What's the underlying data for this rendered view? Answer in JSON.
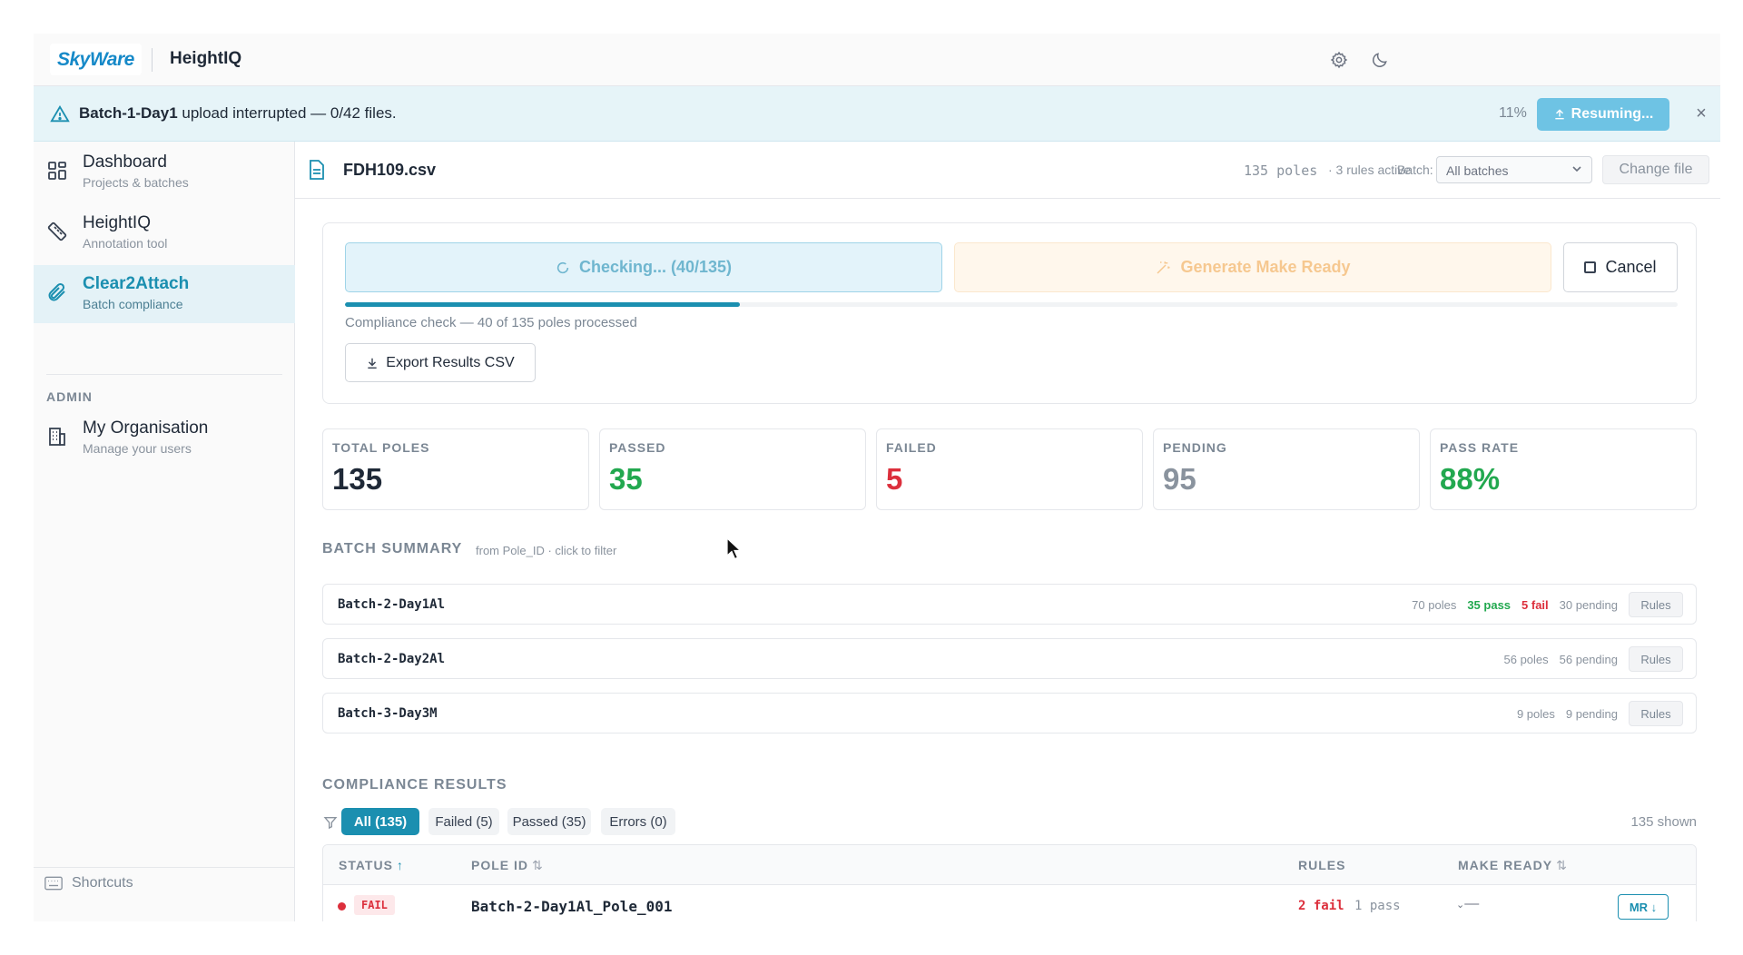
{
  "header": {
    "logo": "SkyWare",
    "app_title": "HeightIQ"
  },
  "banner": {
    "batch": "Batch-1-Day1",
    "message": " upload interrupted — 0/42 files.",
    "percent": "11%",
    "progress_fraction": 0.11,
    "resume_label": "Resuming...",
    "close": "×"
  },
  "sidebar": {
    "items": [
      {
        "label": "Dashboard",
        "sub": "Projects & batches",
        "icon": "dashboard-icon"
      },
      {
        "label": "HeightIQ",
        "sub": "Annotation tool",
        "icon": "ruler-icon"
      },
      {
        "label": "Clear2Attach",
        "sub": "Batch compliance",
        "icon": "paperclip-icon"
      }
    ],
    "admin_label": "ADMIN",
    "admin_items": [
      {
        "label": "My Organisation",
        "sub": "Manage your users",
        "icon": "building-icon"
      }
    ],
    "shortcuts_label": "Shortcuts",
    "collapse": "«"
  },
  "file_bar": {
    "file_name": "FDH109.csv",
    "poles": "135 poles",
    "rules_active": "· 3 rules active",
    "batch_label": "Batch:",
    "batch_value": "All batches",
    "change_file": "Change file"
  },
  "check": {
    "checking_label": "Checking... (40/135)",
    "generate_label": "Generate Make Ready",
    "cancel_label": "Cancel",
    "progress_fraction": 0.296,
    "progress_text": "Compliance check — 40 of 135 poles processed",
    "export_label": "Export Results CSV"
  },
  "stats": [
    {
      "label": "TOTAL POLES",
      "value": "135",
      "color": "#1f2937"
    },
    {
      "label": "PASSED",
      "value": "35",
      "color": "#22a84f"
    },
    {
      "label": "FAILED",
      "value": "5",
      "color": "#dc2f3c"
    },
    {
      "label": "PENDING",
      "value": "95",
      "color": "#8a939e"
    },
    {
      "label": "PASS RATE",
      "value": "88%",
      "color": "#22a84f"
    }
  ],
  "batch_summary": {
    "title": "BATCH SUMMARY",
    "hint": "from Pole_ID · click to filter",
    "rows": [
      {
        "name": "Batch-2-Day1Al",
        "poles": "70 poles",
        "pass": "35 pass",
        "fail": "5 fail",
        "pending": "30 pending",
        "rules": "Rules"
      },
      {
        "name": "Batch-2-Day2Al",
        "poles": "56 poles",
        "pass": "",
        "fail": "",
        "pending": "56 pending",
        "rules": "Rules"
      },
      {
        "name": "Batch-3-Day3M",
        "poles": "9 poles",
        "pass": "",
        "fail": "",
        "pending": "9 pending",
        "rules": "Rules"
      }
    ]
  },
  "results": {
    "title": "COMPLIANCE RESULTS",
    "filters": [
      "All (135)",
      "Failed (5)",
      "Passed (35)",
      "Errors (0)"
    ],
    "shown": "135 shown",
    "columns": {
      "status": "STATUS",
      "pole_id": "POLE ID",
      "rules": "RULES",
      "make_ready": "MAKE READY"
    },
    "rows": [
      {
        "status": "FAIL",
        "pole_id": "Batch-2-Day1Al_Pole_001",
        "rules_fail": "2 fail",
        "rules_pass": "1 pass",
        "make_ready": "—",
        "mr_button": "MR ↓"
      }
    ]
  }
}
